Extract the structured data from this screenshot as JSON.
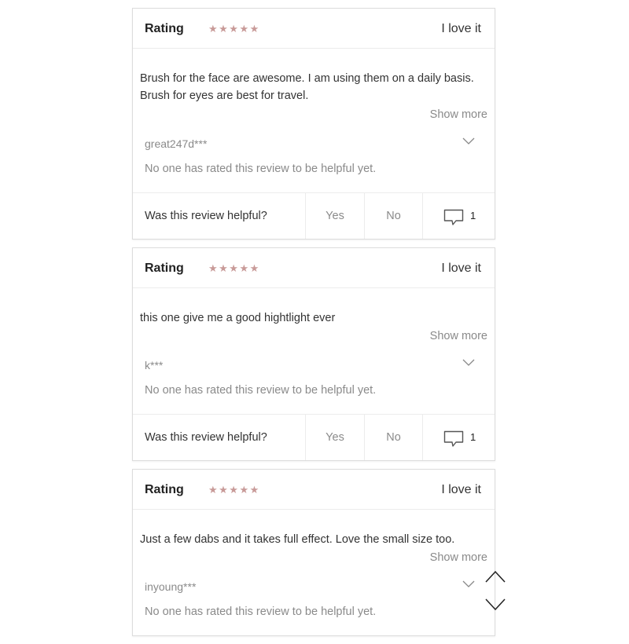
{
  "rating_label": "Rating",
  "reviews": [
    {
      "stars": "★★★★★",
      "verdict": "I love it",
      "text": "Brush for the face are awesome. I am using them on a daily basis. Brush for eyes are best for travel.",
      "show_more": "Show more",
      "username": "great247d***",
      "helpful_status": "No one has rated this review to be helpful yet.",
      "helpful_question": "Was this review helpful?",
      "yes_label": "Yes",
      "no_label": "No",
      "comment_count": "1"
    },
    {
      "stars": "★★★★★",
      "verdict": "I love it",
      "text": "this one give me a good hightlight ever",
      "show_more": "Show more",
      "username": "k***",
      "helpful_status": "No one has rated this review to be helpful yet.",
      "helpful_question": "Was this review helpful?",
      "yes_label": "Yes",
      "no_label": "No",
      "comment_count": "1"
    },
    {
      "stars": "★★★★★",
      "verdict": "I love it",
      "text": "Just a few dabs and it takes full effect. Love the small size too.",
      "show_more": "Show more",
      "username": "inyoung***",
      "helpful_status": "No one has rated this review to be helpful yet."
    }
  ],
  "icons": {
    "star": "star-icon",
    "chevron": "chevron-down-icon",
    "comment": "comment-bubble-icon",
    "scroll_up": "arrow-up-icon",
    "scroll_down": "arrow-down-icon"
  },
  "colors": {
    "star": "#c89a98",
    "muted_text": "#8a8a8a",
    "border": "#dcdcdc"
  }
}
